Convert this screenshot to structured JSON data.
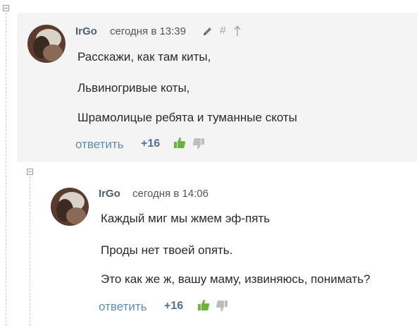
{
  "comments": [
    {
      "author": "IrGo",
      "date": "сегодня в 13:39",
      "lines": [
        "Расскажи, как там киты,",
        "Львиногривые коты,",
        "Шрамолицые ребята и туманные скоты"
      ],
      "reply_label": "ответить",
      "rating": "+16",
      "header_icons": [
        "pencil-icon",
        "hash-icon",
        "arrow-up-icon"
      ],
      "hash_symbol": "#"
    },
    {
      "author": "IrGo",
      "date": "сегодня в 14:06",
      "lines": [
        "Каждый миг мы жмем эф-пять",
        "Проды нет твоей опять.",
        "Это как же ж, вашу маму, извиняюсь, понимать?"
      ],
      "reply_label": "ответить",
      "rating": "+16"
    }
  ],
  "colors": {
    "author": "#4d5e6e",
    "reply_link": "#5d8bb7",
    "rating": "#557098",
    "thumb_up": "#6db33f",
    "thumb_down": "#bdbdbd",
    "highlight_bg": "#f4f4f4"
  }
}
